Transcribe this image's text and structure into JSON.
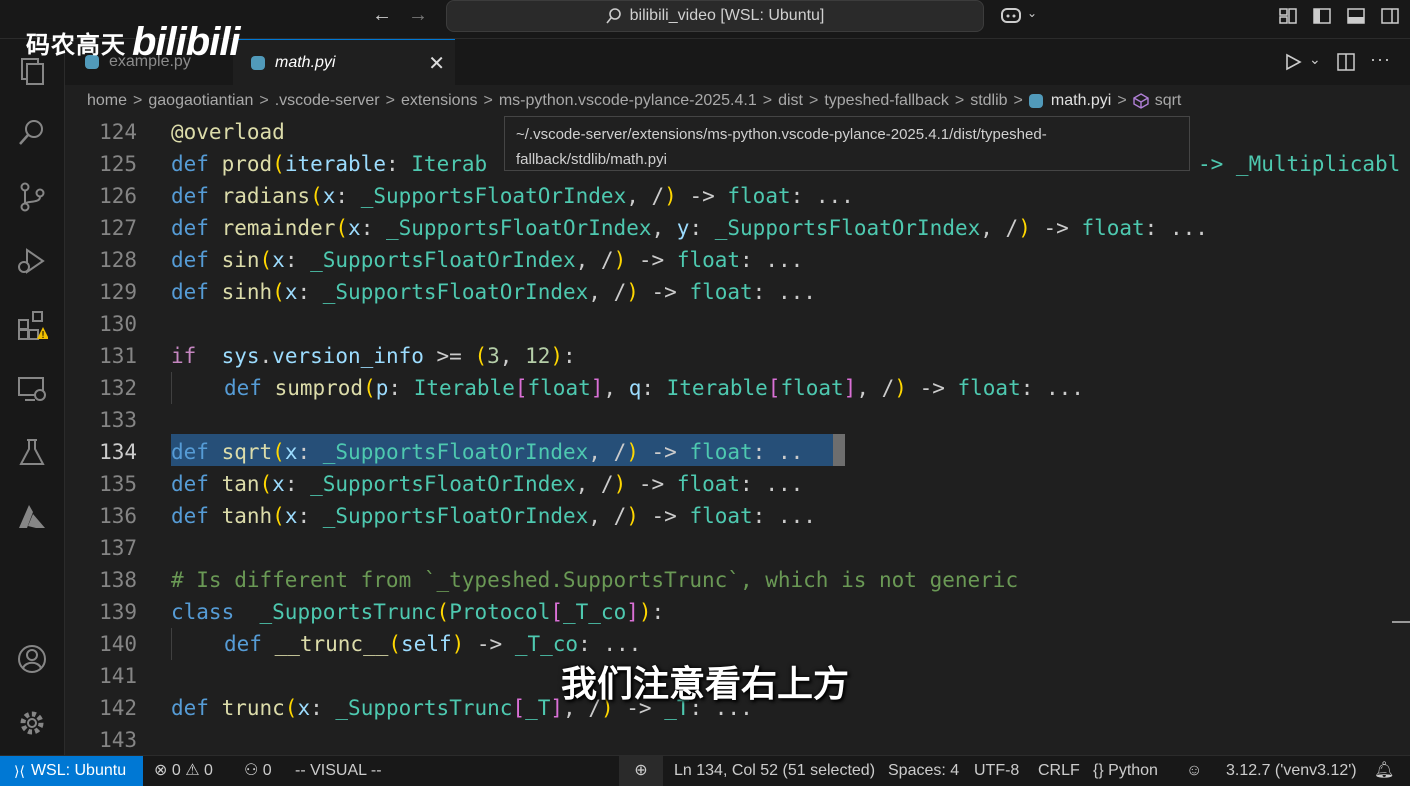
{
  "watermark": {
    "text": "码农高天",
    "brand": "bilibili"
  },
  "titlebar": {
    "title": "bilibili_video [WSL: Ubuntu]"
  },
  "tabs": [
    {
      "label": "example.py"
    },
    {
      "label": "math.pyi"
    }
  ],
  "breadcrumb": [
    "home",
    "gaogaotiantian",
    ".vscode-server",
    "extensions",
    "ms-python.vscode-pylance-2025.4.1",
    "dist",
    "typeshed-fallback",
    "stdlib",
    "math.pyi",
    "sqrt"
  ],
  "tooltip": {
    "line1": "~/.vscode-server/extensions/ms-python.vscode-pylance-2025.4.1/dist/typeshed-",
    "line2": "fallback/stdlib/math.pyi"
  },
  "editor": {
    "line_numbers": [
      "124",
      "125",
      "126",
      "127",
      "128",
      "129",
      "130",
      "131",
      "132",
      "133",
      "134",
      "135",
      "136",
      "137",
      "138",
      "139",
      "140",
      "141",
      "142",
      "143"
    ],
    "current_line": "134",
    "lines": {
      "l124": "@overload",
      "l125a": "def",
      "l125b": "prod",
      "l125c": "(",
      "l125d": "iterable",
      "l125e": ": ",
      "l125f": "Iterab",
      "l125g": "-> _Multiplicabl",
      "l126": [
        "def",
        "radians",
        "(",
        "x",
        ": ",
        "_SupportsFloatOrIndex",
        ", /",
        ")",
        " -> ",
        "float",
        ": ..."
      ],
      "l127": [
        "def",
        "remainder",
        "(",
        "x",
        ": ",
        "_SupportsFloatOrIndex",
        ", ",
        "y",
        ": ",
        "_SupportsFloatOrIndex",
        ", /",
        ")",
        " -> ",
        "float",
        ": ..."
      ],
      "l128": [
        "def",
        "sin",
        "(",
        "x",
        ": ",
        "_SupportsFloatOrIndex",
        ", /",
        ")",
        " -> ",
        "float",
        ": ..."
      ],
      "l129": [
        "def",
        "sinh",
        "(",
        "x",
        ": ",
        "_SupportsFloatOrIndex",
        ", /",
        ")",
        " -> ",
        "float",
        ": ..."
      ],
      "l131": [
        "if",
        " sys",
        ".",
        "version_info",
        " >= ",
        "(",
        "3",
        ", ",
        "12",
        ")",
        ":"
      ],
      "l132": [
        "def",
        "sumprod",
        "(",
        "p",
        ": ",
        "Iterable",
        "[",
        "float",
        "]",
        ", ",
        "q",
        ": ",
        "Iterable",
        "[",
        "float",
        "]",
        ", /",
        ")",
        " -> ",
        "float",
        ": ..."
      ],
      "l134": [
        "def",
        "sqrt",
        "(",
        "x",
        ": ",
        "_SupportsFloatOrIndex",
        ", /",
        ")",
        " -> ",
        "float",
        ": .."
      ],
      "l135": [
        "def",
        "tan",
        "(",
        "x",
        ": ",
        "_SupportsFloatOrIndex",
        ", /",
        ")",
        " -> ",
        "float",
        ": ..."
      ],
      "l136": [
        "def",
        "tanh",
        "(",
        "x",
        ": ",
        "_SupportsFloatOrIndex",
        ", /",
        ")",
        " -> ",
        "float",
        ": ..."
      ],
      "l138": "# Is different from `_typeshed.SupportsTrunc`, which is not generic",
      "l139": [
        "class",
        " ",
        "_SupportsTrunc",
        "(",
        "Protocol",
        "[",
        "_T_co",
        "]",
        ")",
        ":"
      ],
      "l140": [
        "def",
        "__trunc__",
        "(",
        "self",
        ")",
        " -> ",
        "_T_co",
        ": ..."
      ],
      "l142": [
        "def",
        "trunc",
        "(",
        "x",
        ": ",
        "_SupportsTrunc",
        "[",
        "_T",
        "]",
        ", /",
        ")",
        " -> ",
        "_T",
        ": ..."
      ]
    }
  },
  "subtitle": "我们注意看右上方",
  "statusbar": {
    "remote": "WSL: Ubuntu",
    "errors": "0",
    "warnings": "0",
    "ports": "0",
    "mode": "-- VISUAL --",
    "position": "Ln 134, Col 52 (51 selected)",
    "spaces": "Spaces: 4",
    "encoding": "UTF-8",
    "eol": "CRLF",
    "language": "Python",
    "interpreter": "3.12.7 ('venv3.12')"
  },
  "colors": {
    "accent": "#0078d4",
    "keyword": "#569cd6",
    "function": "#dcdcaa",
    "type": "#4ec9b0",
    "param": "#9cdcfe",
    "comment": "#6a9955"
  }
}
